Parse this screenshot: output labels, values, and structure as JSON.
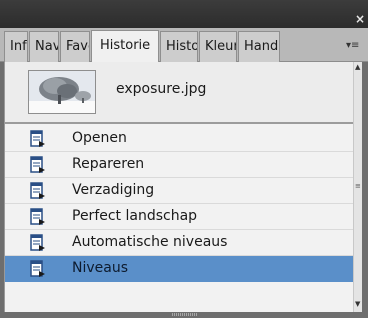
{
  "window": {
    "close_glyph": "×"
  },
  "tabs": [
    {
      "label": "Info",
      "active": false
    },
    {
      "label": "Navigator",
      "active": false
    },
    {
      "label": "Favorieten",
      "active": false
    },
    {
      "label": "Historie",
      "active": true
    },
    {
      "label": "Histogram",
      "active": false
    },
    {
      "label": "Kleur",
      "active": false
    },
    {
      "label": "Handelingen",
      "active": false
    }
  ],
  "tab_menu_glyph": "▾≡",
  "snapshot": {
    "name": "exposure.jpg",
    "icon": "tree-thumbnail"
  },
  "history": [
    {
      "label": "Openen",
      "selected": false
    },
    {
      "label": "Repareren",
      "selected": false
    },
    {
      "label": "Verzadiging",
      "selected": false
    },
    {
      "label": "Perfect landschap",
      "selected": false
    },
    {
      "label": "Automatische niveaus",
      "selected": false
    },
    {
      "label": "Niveaus",
      "selected": true
    }
  ],
  "colors": {
    "selected_row": "#5a8fc9",
    "panel_bg": "#f2f2f2",
    "titlebar": "#333333"
  }
}
